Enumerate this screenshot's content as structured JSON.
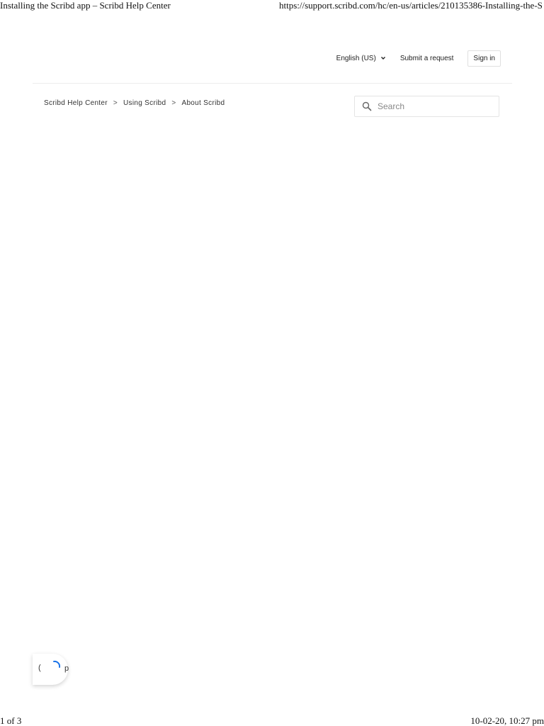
{
  "print_header": {
    "title": "Installing the Scribd app – Scribd Help Center",
    "url": "https://support.scribd.com/hc/en-us/articles/210135386-Installing-the-Sc..."
  },
  "print_footer": {
    "page": "1 of 3",
    "datetime": "10-02-20, 10:27 pm"
  },
  "top_nav": {
    "language": "English (US)",
    "submit_request": "Submit a request",
    "sign_in": "Sign in"
  },
  "breadcrumb": {
    "items": [
      "Scribd Help Center",
      "Using Scribd",
      "About Scribd"
    ],
    "separator": ">"
  },
  "search": {
    "placeholder": "Search"
  },
  "chat_widget": {
    "glyph_left": "(",
    "glyph_right": "p"
  },
  "icons": {
    "chevron": "chevron-down-icon",
    "search": "search-icon",
    "spinner": "loading-spinner-icon"
  },
  "colors": {
    "text": "#222222",
    "border": "#e0e0e0",
    "spinner": "#1a73e8"
  }
}
